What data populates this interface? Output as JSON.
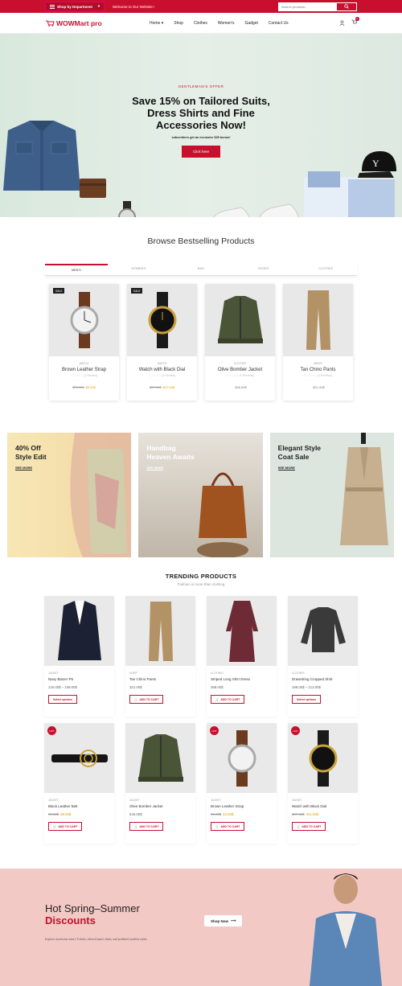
{
  "topbar": {
    "department_label": "Shop by Department",
    "welcome": "Welcome to Our Website !",
    "search_placeholder": "Search products..."
  },
  "nav": {
    "logo_text": "WOWMart pro",
    "menu": [
      "Home",
      "Shop",
      "Clothes",
      "Women's",
      "Gadget",
      "Contact Us"
    ],
    "cart_count": "0"
  },
  "hero": {
    "eyebrow": "GENTLEMAN'S OFFER",
    "title": "Save 15% on Tailored Suits, Dress Shirts and Fine Accessories Now!",
    "subtitle": "subscribers get an exclusive $25 bonus!",
    "button": "Click here",
    "background": "#dde9e0"
  },
  "bestselling": {
    "title": "Browse Bestselling Products",
    "tabs": [
      "MEN'S",
      "WOMEN'S",
      "BAG",
      "SHOES",
      "CLOTHES"
    ],
    "products": [
      {
        "badge": "SALE",
        "category": "WATCH",
        "name": "Brown Leather Strap",
        "rating": "☆☆☆☆☆ (2 Review)",
        "old_price": "$99.00$",
        "price": "$5.00$"
      },
      {
        "badge": "SALE",
        "category": "WATCH",
        "name": "Watch with Black Dial",
        "rating": "☆☆☆☆☆ (1 Review)",
        "old_price": "$97.00$",
        "price": "$21.00$"
      },
      {
        "badge": "",
        "category": "CLOTHES",
        "name": "Olive Bomber Jacket",
        "rating": "☆☆☆☆☆ (2 Reviews)",
        "old_price": "",
        "price": "$46.00$"
      },
      {
        "badge": "",
        "category": "MEN'S",
        "name": "Tan Chino Pants",
        "rating": "☆☆☆☆☆ (2 Reviews)",
        "old_price": "",
        "price": "$21.00$"
      }
    ]
  },
  "banners": [
    {
      "title_1": "40% Off",
      "title_2": "Style Edit",
      "link": "SEE MORE",
      "bg": "#f3dca5"
    },
    {
      "title_1": "Handbag",
      "title_2": "Heaven Awaits",
      "link": "SEE MORE",
      "bg": "#d8d2c8"
    },
    {
      "title_1": "Elegant Style",
      "title_2": "Coat Sale",
      "link": "SEE MORE",
      "bg": "#dce6de"
    }
  ],
  "trending": {
    "title": "TRENDING PRODUCTS",
    "subtitle": "Fashion is more than clothing",
    "products": [
      {
        "category": "JACKET",
        "name": "Navy Blazer P6",
        "price": "140.00$ – 169.00$",
        "old_price": "",
        "button": "Select options",
        "hot": ""
      },
      {
        "category": "SHIRT",
        "name": "Tan Chino Pants",
        "price": "321.00$",
        "old_price": "",
        "button": "ADD TO CART",
        "hot": ""
      },
      {
        "category": "CLOTHES",
        "name": "Striped Long Shirt Dress",
        "price": "388.00$",
        "old_price": "",
        "button": "ADD TO CART",
        "hot": ""
      },
      {
        "category": "CLOTHES",
        "name": "Drawstring Cropped Shirt",
        "price": "188.00$ – 213.00$",
        "old_price": "",
        "button": "Select options",
        "hot": ""
      },
      {
        "category": "JACKET",
        "name": "Black Leather Belt",
        "price": "89.00$",
        "old_price": "99.00$",
        "button": "ADD TO CART",
        "hot": "HOT"
      },
      {
        "category": "JACKET",
        "name": "Olive Bomber Jacket",
        "price": "546.00$",
        "old_price": "",
        "button": "ADD TO CART",
        "hot": ""
      },
      {
        "category": "JACKET",
        "name": "Brown Leather Strap",
        "price": "53.00$",
        "old_price": "99.00$",
        "button": "ADD TO CART",
        "hot": "HOT"
      },
      {
        "category": "JACKET",
        "name": "Watch with Black Dial",
        "price": "321.00$",
        "old_price": "387.00$",
        "button": "ADD TO CART",
        "hot": "HOT"
      }
    ]
  },
  "promo": {
    "title_1": "Hot Spring–Summer",
    "title_2": "Discounts",
    "description": "Explore streetwear men's T-shirts, relaxed man's shirts, and polished, modern styles",
    "button": "Shop Now",
    "background": "#f2c9c4"
  },
  "colors": {
    "accent": "#c8102e",
    "sale_price": "#e0a000"
  }
}
